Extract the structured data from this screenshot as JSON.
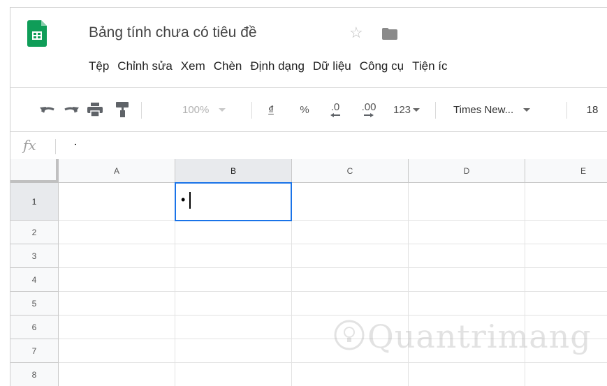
{
  "document": {
    "title": "Bảng tính chưa có tiêu đề"
  },
  "menu": [
    "Tệp",
    "Chỉnh sửa",
    "Xem",
    "Chèn",
    "Định dạng",
    "Dữ liệu",
    "Công cụ",
    "Tiện íc"
  ],
  "toolbar": {
    "zoom": "100%",
    "currency": "₫",
    "percent": "%",
    "decrease_decimal": ".0",
    "increase_decimal": ".00",
    "more_formats": "123",
    "font": "Times New...",
    "font_size": "18"
  },
  "formula_bar": {
    "fx_label": "fx",
    "content": "·"
  },
  "columns": [
    "A",
    "B",
    "C",
    "D",
    "E"
  ],
  "rows": [
    "1",
    "2",
    "3",
    "4",
    "5",
    "6",
    "7",
    "8"
  ],
  "active_cell": {
    "ref": "B1",
    "value": "•"
  },
  "watermark": {
    "text": "Quantrimang"
  },
  "colors": {
    "selection": "#1a73e8",
    "sheets_green": "#0f9d58"
  },
  "icons": [
    "sheets-logo-icon",
    "star-icon",
    "folder-icon",
    "undo-icon",
    "redo-icon",
    "print-icon",
    "paint-format-icon"
  ]
}
